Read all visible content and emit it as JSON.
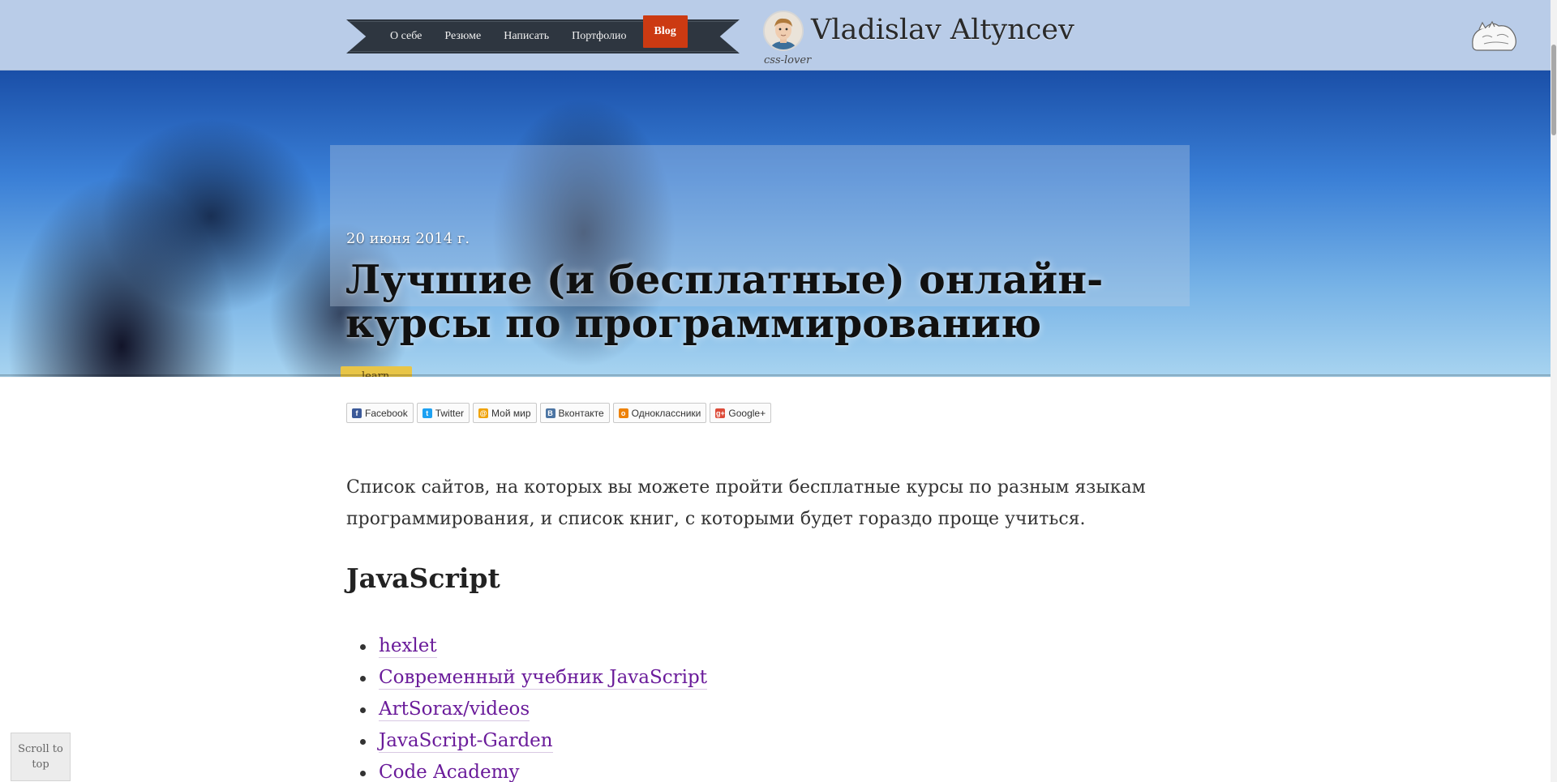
{
  "nav": {
    "items": [
      {
        "label": "О себе"
      },
      {
        "label": "Резюме"
      },
      {
        "label": "Написать"
      },
      {
        "label": "Портфолио"
      }
    ],
    "active_label": "Blog"
  },
  "brand": {
    "title": "Vladislav Altyncev",
    "subtitle": "css-lover"
  },
  "post": {
    "date": "20 июня 2014 г.",
    "title": "Лучшие (и бесплатные) онлайн-курсы по программированию",
    "tag": "learn"
  },
  "share": [
    {
      "label": "Facebook",
      "icon": "facebook-icon",
      "glyph": "f",
      "color": "#3b5998"
    },
    {
      "label": "Twitter",
      "icon": "twitter-icon",
      "glyph": "t",
      "color": "#1da1f2"
    },
    {
      "label": "Мой мир",
      "icon": "mymir-icon",
      "glyph": "@",
      "color": "#f0a30a"
    },
    {
      "label": "Вконтакте",
      "icon": "vk-icon",
      "glyph": "В",
      "color": "#4c75a3"
    },
    {
      "label": "Одноклассники",
      "icon": "odnoklassniki-icon",
      "glyph": "о",
      "color": "#ee8208"
    },
    {
      "label": "Google+",
      "icon": "googleplus-icon",
      "glyph": "g+",
      "color": "#dd4b39"
    }
  ],
  "content": {
    "intro": "Список сайтов, на которых вы можете пройти бесплатные курсы по разным языкам программирования, и список книг, с которыми будет гораздо проще учиться.",
    "section_heading": "JavaScript",
    "links": [
      {
        "label": "hexlet"
      },
      {
        "label": "Современный учебник JavaScript"
      },
      {
        "label": "ArtSorax/videos"
      },
      {
        "label": "JavaScript-Garden"
      },
      {
        "label": "Code Academy"
      }
    ]
  },
  "scroll_top": {
    "label": "Scroll to top"
  },
  "colors": {
    "topbar": "#b9cce8",
    "nav_bg": "#2e3640",
    "nav_active": "#cc3a12",
    "link": "#6a1b9a"
  }
}
